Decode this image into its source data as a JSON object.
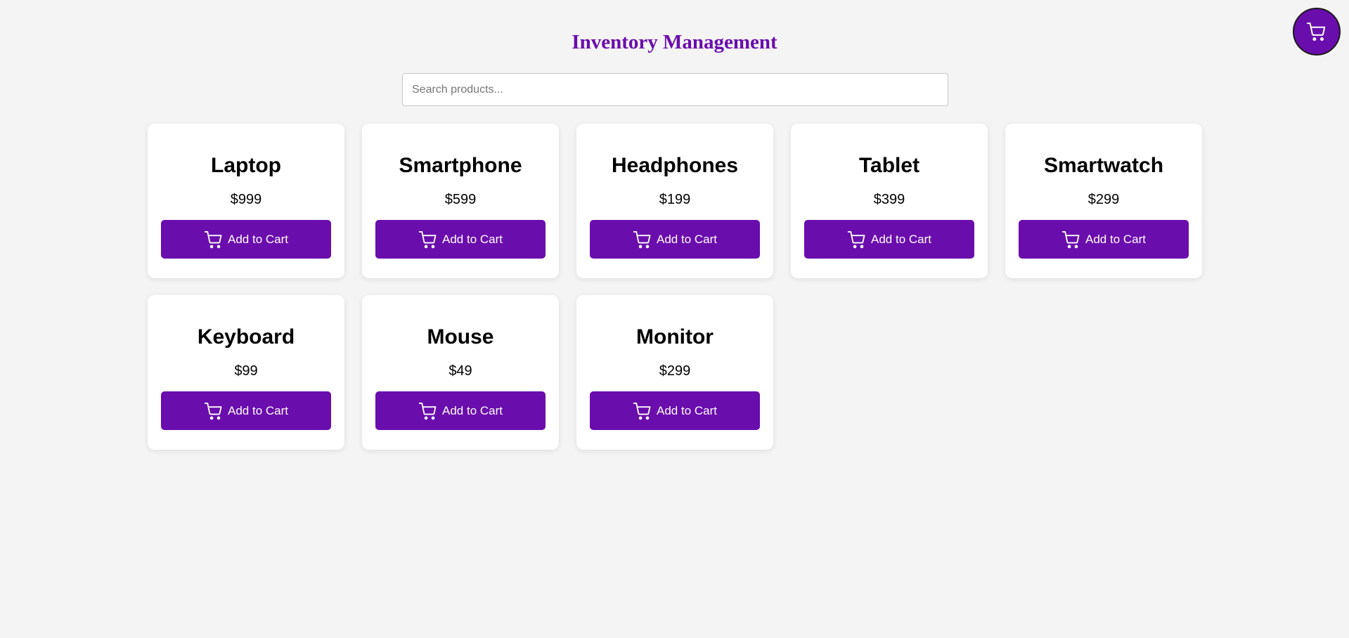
{
  "header": {
    "title": "Inventory Management"
  },
  "search": {
    "placeholder": "Search products...",
    "value": ""
  },
  "cart_icon": "cart-icon",
  "colors": {
    "accent": "#6a0dad",
    "background": "#f4f4f4",
    "card": "#ffffff"
  },
  "products": [
    {
      "name": "Laptop",
      "price": "$999",
      "button": "Add to Cart"
    },
    {
      "name": "Smartphone",
      "price": "$599",
      "button": "Add to Cart"
    },
    {
      "name": "Headphones",
      "price": "$199",
      "button": "Add to Cart"
    },
    {
      "name": "Tablet",
      "price": "$399",
      "button": "Add to Cart"
    },
    {
      "name": "Smartwatch",
      "price": "$299",
      "button": "Add to Cart"
    },
    {
      "name": "Keyboard",
      "price": "$99",
      "button": "Add to Cart"
    },
    {
      "name": "Mouse",
      "price": "$49",
      "button": "Add to Cart"
    },
    {
      "name": "Monitor",
      "price": "$299",
      "button": "Add to Cart"
    }
  ]
}
